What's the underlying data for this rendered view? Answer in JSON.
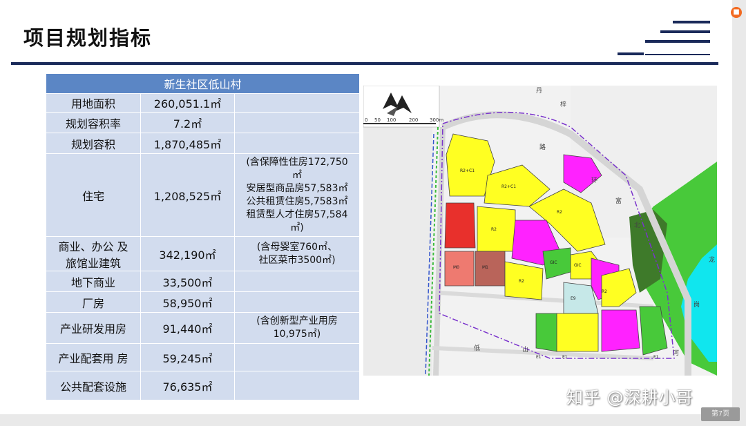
{
  "slide": {
    "title": "项目规划指标",
    "page_label": "第7页",
    "watermark": "知乎 @深耕小哥"
  },
  "table": {
    "header": "新生社区低山村",
    "rows": [
      {
        "label": "用地面积",
        "value": "260,051.1㎡",
        "note": ""
      },
      {
        "label": "规划容积率",
        "value": "7.2㎡",
        "note": ""
      },
      {
        "label": "规划容积",
        "value": "1,870,485㎡",
        "note": ""
      },
      {
        "label": "住宅",
        "value": "1,208,525㎡",
        "note": "(含保障性住房172,750\n㎡\n安居型商品房57,583㎡\n公共租赁住房5,7583㎡\n租赁型人才住房57,584\n㎡)"
      },
      {
        "label": "商业、办公 及\n旅馆业建筑",
        "value": "342,190㎡",
        "note": "(含母婴室760㎡、\n社区菜市3500㎡)"
      },
      {
        "label": "地下商业",
        "value": "33,500㎡",
        "note": ""
      },
      {
        "label": "厂房",
        "value": "58,950㎡",
        "note": ""
      },
      {
        "label": "产业研发用房",
        "value": "91,440㎡",
        "note": "(含创新型产业用房\n10,975㎡)"
      },
      {
        "label": "产业配套用 房",
        "value": "59,245㎡",
        "note": ""
      },
      {
        "label": "公共配套设施",
        "value": "76,635㎡",
        "note": ""
      }
    ]
  },
  "map": {
    "scale_labels": [
      "0",
      "50",
      "100",
      "200",
      "300m"
    ],
    "road_labels": [
      "丹",
      "梓",
      "路",
      "环",
      "富",
      "北",
      "龙",
      "岗",
      "河",
      "低",
      "山"
    ],
    "parcel_labels": [
      "R2+C1",
      "R2+C1",
      "R2",
      "R2",
      "R2",
      "R2",
      "M0",
      "M1",
      "GIC",
      "GIC",
      "E9",
      "E1",
      "E1",
      "E1"
    ],
    "colors": {
      "residential": "#ffff22",
      "commercial": "#ff22ff",
      "industrial_red": "#e8302c",
      "industrial_pink": "#ee7a70",
      "industrial_brown": "#b9645a",
      "green": "#44cc33",
      "dark_green": "#3e7a2a",
      "river": "#10e6ee",
      "school": "#c6e8e8"
    }
  }
}
